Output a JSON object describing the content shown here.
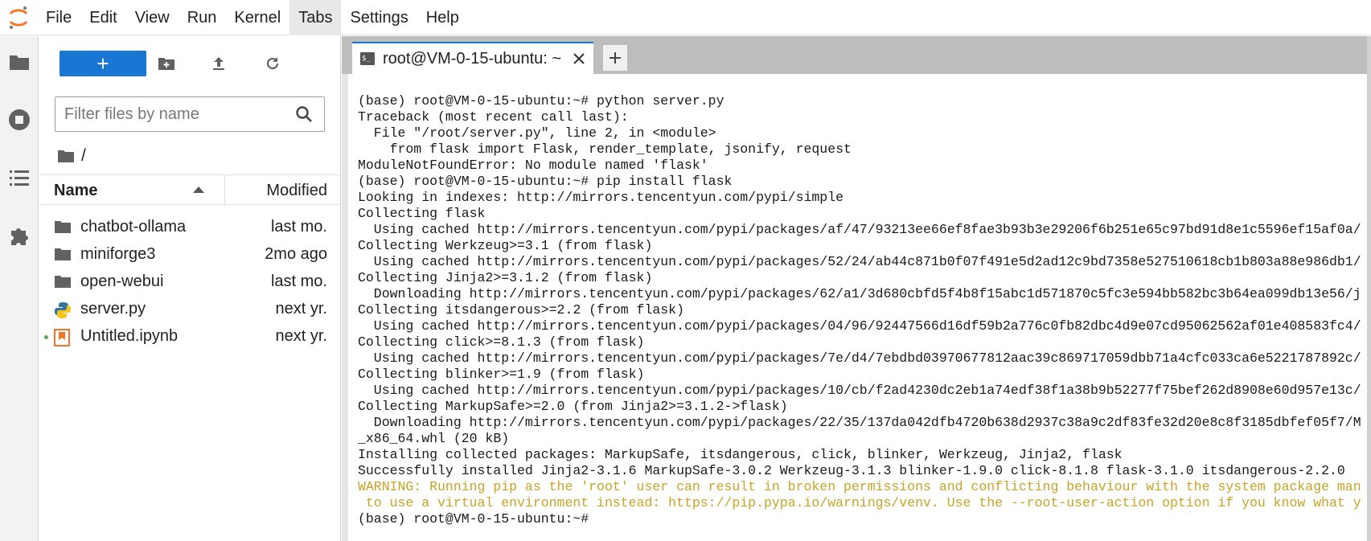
{
  "menu": [
    "File",
    "Edit",
    "View",
    "Run",
    "Kernel",
    "Tabs",
    "Settings",
    "Help"
  ],
  "menu_active": "Tabs",
  "new_button_label": "+",
  "filter": {
    "placeholder": "Filter files by name",
    "value": ""
  },
  "breadcrumb": "/",
  "list_header": {
    "name": "Name",
    "modified": "Modified"
  },
  "files": [
    {
      "name": "chatbot-ollama",
      "modified": "last mo.",
      "type": "folder"
    },
    {
      "name": "miniforge3",
      "modified": "2mo ago",
      "type": "folder"
    },
    {
      "name": "open-webui",
      "modified": "last mo.",
      "type": "folder"
    },
    {
      "name": "server.py",
      "modified": "next yr.",
      "type": "python"
    },
    {
      "name": "Untitled.ipynb",
      "modified": "next yr.",
      "type": "notebook",
      "running": true
    }
  ],
  "tab": {
    "label": "root@VM-0-15-ubuntu: ~",
    "icon": "$_"
  },
  "terminal_lines": [
    {
      "text": "(base) root@VM-0-15-ubuntu:~# python server.py"
    },
    {
      "text": "Traceback (most recent call last):"
    },
    {
      "text": "  File \"/root/server.py\", line 2, in <module>"
    },
    {
      "text": "    from flask import Flask, render_template, jsonify, request"
    },
    {
      "text": "ModuleNotFoundError: No module named 'flask'"
    },
    {
      "text": "(base) root@VM-0-15-ubuntu:~# pip install flask"
    },
    {
      "text": "Looking in indexes: http://mirrors.tencentyun.com/pypi/simple"
    },
    {
      "text": "Collecting flask"
    },
    {
      "text": "  Using cached http://mirrors.tencentyun.com/pypi/packages/af/47/93213ee66ef8fae3b93b3e29206f6b251e65c97bd91d8e1c5596ef15af0a/"
    },
    {
      "text": "Collecting Werkzeug>=3.1 (from flask)"
    },
    {
      "text": "  Using cached http://mirrors.tencentyun.com/pypi/packages/52/24/ab44c871b0f07f491e5d2ad12c9bd7358e527510618cb1b803a88e986db1/"
    },
    {
      "text": "Collecting Jinja2>=3.1.2 (from flask)"
    },
    {
      "text": "  Downloading http://mirrors.tencentyun.com/pypi/packages/62/a1/3d680cbfd5f4b8f15abc1d571870c5fc3e594bb582bc3b64ea099db13e56/j"
    },
    {
      "text": "Collecting itsdangerous>=2.2 (from flask)"
    },
    {
      "text": "  Using cached http://mirrors.tencentyun.com/pypi/packages/04/96/92447566d16df59b2a776c0fb82dbc4d9e07cd95062562af01e408583fc4/"
    },
    {
      "text": "Collecting click>=8.1.3 (from flask)"
    },
    {
      "text": "  Using cached http://mirrors.tencentyun.com/pypi/packages/7e/d4/7ebdbd03970677812aac39c869717059dbb71a4cfc033ca6e5221787892c/"
    },
    {
      "text": "Collecting blinker>=1.9 (from flask)"
    },
    {
      "text": "  Using cached http://mirrors.tencentyun.com/pypi/packages/10/cb/f2ad4230dc2eb1a74edf38f1a38b9b52277f75bef262d8908e60d957e13c/"
    },
    {
      "text": "Collecting MarkupSafe>=2.0 (from Jinja2>=3.1.2->flask)"
    },
    {
      "text": "  Downloading http://mirrors.tencentyun.com/pypi/packages/22/35/137da042dfb4720b638d2937c38a9c2df83fe32d20e8c8f3185dbfef05f7/M"
    },
    {
      "text": "_x86_64.whl (20 kB)"
    },
    {
      "text": "Installing collected packages: MarkupSafe, itsdangerous, click, blinker, Werkzeug, Jinja2, flask"
    },
    {
      "text": "Successfully installed Jinja2-3.1.6 MarkupSafe-3.0.2 Werkzeug-3.1.3 blinker-1.9.0 click-8.1.8 flask-3.1.0 itsdangerous-2.2.0"
    },
    {
      "text": "WARNING: Running pip as the 'root' user can result in broken permissions and conflicting behaviour with the system package man",
      "warn": true
    },
    {
      "text": " to use a virtual environment instead: https://pip.pypa.io/warnings/venv. Use the --root-user-action option if you know what y",
      "warn": true
    },
    {
      "text": "(base) root@VM-0-15-ubuntu:~# "
    }
  ],
  "colors": {
    "accent": "#1976d2",
    "warning": "#c9a227",
    "folder": "#616161",
    "notebook": "#f37726"
  }
}
